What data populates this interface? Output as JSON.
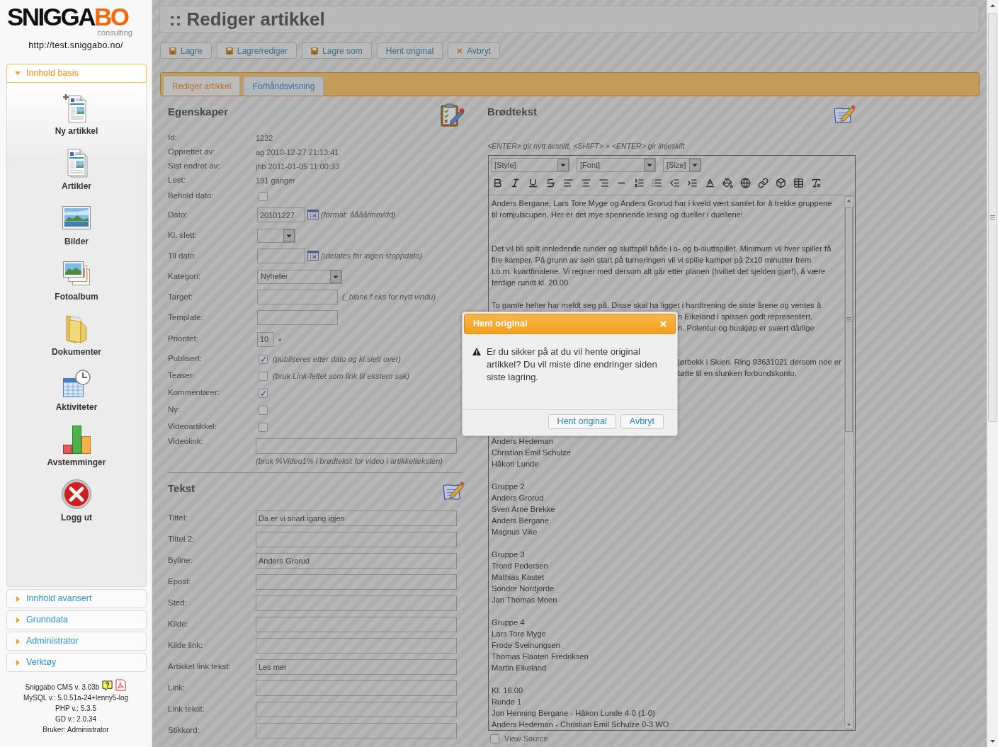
{
  "sidebar": {
    "logo": {
      "wordmark_dark": "SNIGGA",
      "wordmark_accent": "BO",
      "tagline": "consulting"
    },
    "site_url": "http://test.sniggabo.no/",
    "sections": [
      {
        "title": "Innhold basis",
        "expanded": true,
        "items": [
          {
            "label": "Ny artikkel",
            "kind": "new_article"
          },
          {
            "label": "Artikler",
            "kind": "articles"
          },
          {
            "label": "Bilder",
            "kind": "images"
          },
          {
            "label": "Fotoalbum",
            "kind": "photo_album"
          },
          {
            "label": "Dokumenter",
            "kind": "documents"
          },
          {
            "label": "Aktiviteter",
            "kind": "activities"
          },
          {
            "label": "Avstemminger",
            "kind": "polls"
          },
          {
            "label": "Logg ut",
            "kind": "logout"
          }
        ]
      },
      {
        "title": "Innhold avansert",
        "expanded": false
      },
      {
        "title": "Grunndata",
        "expanded": false
      },
      {
        "title": "Administrator",
        "expanded": false
      },
      {
        "title": "Verktøy",
        "expanded": false
      }
    ],
    "footer": {
      "version": "Sniggabo CMS v. 3.03b",
      "lines": [
        "MySQL v.: 5.0.51a-24+lenny5-log",
        "PHP v.: 5.3.5",
        "GD v.: 2.0.34",
        "Bruker: Administrator"
      ]
    }
  },
  "page_title": ":: Rediger artikkel",
  "actions": [
    {
      "label": "Lagre",
      "kind": "save"
    },
    {
      "label": "Lagre/rediger",
      "kind": "save"
    },
    {
      "label": "Lagre som",
      "kind": "save"
    },
    {
      "label": "Hent original",
      "kind": "plain"
    },
    {
      "label": "Avbryt",
      "kind": "cancel"
    }
  ],
  "tabs": [
    {
      "label": "Rediger artikkel",
      "selected": true
    },
    {
      "label": "Forhåndsvisning",
      "selected": false
    }
  ],
  "properties": {
    "title": "Egenskaper",
    "fields": [
      {
        "label": "Id:",
        "kind": "text",
        "value": "1232"
      },
      {
        "label": "Opprettet av:",
        "kind": "text",
        "value": "ag 2010-12-27 21:13:41"
      },
      {
        "label": "Sist endret av:",
        "kind": "text",
        "value": "jhb 2011-01-05 11:00:33"
      },
      {
        "label": "Lest:",
        "kind": "text",
        "value": "191 ganger"
      },
      {
        "label": "Behold dato:",
        "kind": "checkbox",
        "checked": false
      },
      {
        "label": "Dato:",
        "kind": "date",
        "value": "20101227",
        "hint": "(format: åååå/mm/dd)"
      },
      {
        "label": "Kl. slett:",
        "kind": "select_small"
      },
      {
        "label": "Til dato:",
        "kind": "date",
        "hint": "(utelates for ingen stoppdato)"
      },
      {
        "label": "Kategori:",
        "kind": "select",
        "value": "Nyheter"
      },
      {
        "label": "Target:",
        "kind": "input",
        "hint": "(_blank f.eks for nytt vindu)"
      },
      {
        "label": "Template:",
        "kind": "input"
      },
      {
        "label": "Prioritet:",
        "kind": "short_input",
        "value": "10",
        "hint": "*"
      },
      {
        "label": "Publisert:",
        "kind": "checkbox",
        "checked": true,
        "hint": "(publiseres etter dato og kl.slett over)"
      },
      {
        "label": "Teaser:",
        "kind": "checkbox",
        "checked": false,
        "hint": "(bruk Link-feltet som link til ekstern sak)"
      },
      {
        "label": "Kommentarer:",
        "kind": "checkbox",
        "checked": true
      },
      {
        "label": "Ny:",
        "kind": "checkbox",
        "checked": false
      },
      {
        "label": "Videoartikkel:",
        "kind": "checkbox",
        "checked": false
      },
      {
        "label": "Videolink:",
        "kind": "wide_input",
        "hint": "(bruk %Video1% i brødtekst for video i artikkelteksten)"
      }
    ]
  },
  "text_section": {
    "title": "Tekst",
    "fields": [
      {
        "label": "Tittel:",
        "value": "Da er vi snart igang igjen"
      },
      {
        "label": "Tittel 2:"
      },
      {
        "label": "Byline:",
        "value": "Anders Grorud"
      },
      {
        "label": "Epost:"
      },
      {
        "label": "Sted:"
      },
      {
        "label": "Kilde:"
      },
      {
        "label": "Kilde link:"
      },
      {
        "label": "Artikkel link tekst:",
        "value": "Les mer"
      },
      {
        "label": "Link:"
      },
      {
        "label": "Link tekst:"
      },
      {
        "label": "Stikkord:"
      }
    ]
  },
  "body_text": {
    "title": "Brødtekst",
    "hint": "<ENTER> gir nytt avsnitt, <SHIFT> + <ENTER> gir linjeskift",
    "toolbar": {
      "style": "[Style]",
      "font": "[Font]",
      "size": "[Size]"
    },
    "paragraphs": [
      [
        "Anders Bergane, Lars Tore Myge og Anders Grorud har i kveld vært samlet for å trekke gruppene",
        "til romjulscupen. Her er det mye spennende lesing og dueller i duellene!"
      ],
      [
        "Det vil bli spilt innledende runder og sluttspill både i a- og b-sluttspillet. Minimum vil hver spiller få",
        "fire kamper. På grunn av sein start på turneringen vil vi spille kamper på 2x10 minutter frem",
        "t.o.m. kvartfinalene. Vi regner med dersom alt går etter planen (hviltet det sjelden gjør!), å være",
        "ferdige rundt kl. 20.00."
      ],
      [
        "To gamle helter har meldt seg på. Disse skal ha ligget i hardtrening de siste årene og ventes å"
      ]
    ],
    "beside_dialog": [
      [
        "n Eikeland i spissen godt representert.",
        "n. Polentur og huskjøp er svært dårlige"
      ],
      [
        "jørbekk i Skien. Ring 93631021 dersom noe er",
        "tøtte til en slunken forbundskonto."
      ]
    ],
    "below_dialog": [
      [
        "Anders Hedeman",
        "Christian Emil Schulze",
        "Håkon Lunde"
      ],
      [
        "Gruppe 2",
        "Anders Grorud",
        "Sven Arne Brekke",
        "Anders Bergane",
        "Magnus Vike"
      ],
      [
        "Gruppe 3",
        "Trond Pedersen",
        "Mathias Kastet",
        "Sondre Nordjorde",
        "Jan Thomas Moen"
      ],
      [
        "Gruppe 4",
        "Lars Tore Myge",
        "Frode Sveinungsen",
        "Thomas Flaaten Fredriksen",
        "Martin Eikeland"
      ],
      [
        "Kl. 16.00",
        "Runde 1",
        "Jon Henning Bergane - Håkon Lunde 4-0 (1-0)",
        "Anders Hedeman - Christian Emil Schulze 0-3 WO"
      ]
    ],
    "view_source": {
      "label": "View Source",
      "checked": false
    }
  },
  "dialog": {
    "title": "Hent original",
    "message": "Er du sikker på at du vil hente original artikkel? Du vil miste dine endringer siden siste lagring.",
    "buttons": [
      "Hent original",
      "Avbryt"
    ]
  }
}
